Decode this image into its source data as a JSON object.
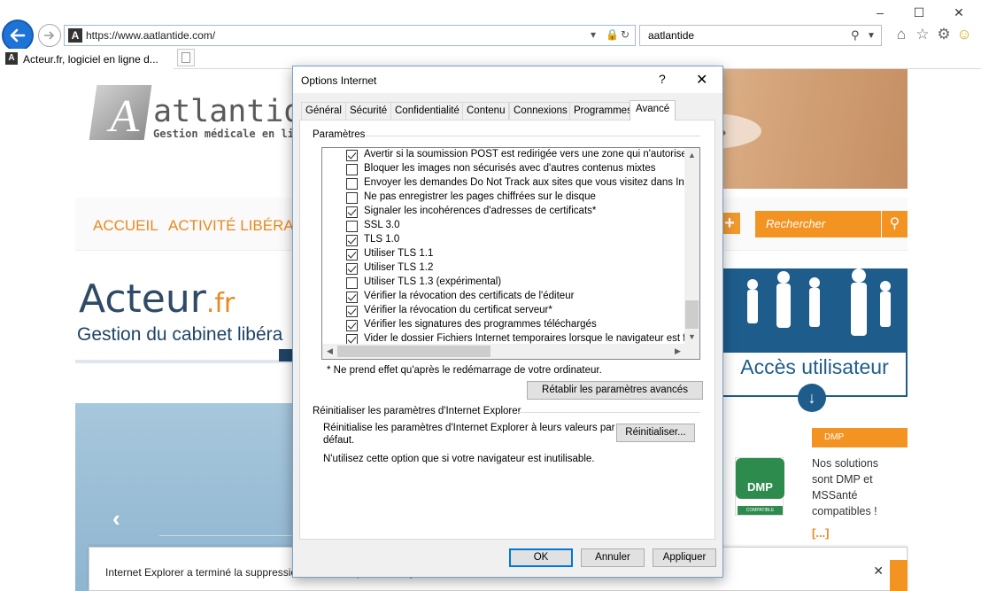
{
  "browser": {
    "url": "https://www.aatlantide.com/",
    "search_query": "aatlantide",
    "tab_title": "Acteur.fr, logiciel en ligne d..."
  },
  "webpage": {
    "logo_text": "atlantide",
    "logo_sub": "Gestion médicale en li",
    "menu": [
      "ACCUEIL",
      "ACTIVITÉ LIBÉRAL"
    ],
    "search_placeholder": "Rechercher",
    "acteur_title": "Acteur",
    "acteur_ext": ".fr",
    "acteur_sub": "Gestion du cabinet libéra",
    "user_access": "Accès utilisateur",
    "dmp_header": "DMP",
    "dmp_logo": "DMP",
    "dmp_logo_caption": "COMPATIBLE",
    "dmp_text": "Nos solutions sont DMP et MSSanté compatibles !",
    "dmp_more": "[...]"
  },
  "notification": {
    "text": "Internet Explorer a terminé la suppression de l'historique de navigation sélectionner."
  },
  "dialog": {
    "title": "Options Internet",
    "help": "?",
    "tabs": [
      "Général",
      "Sécurité",
      "Confidentialité",
      "Contenu",
      "Connexions",
      "Programmes",
      "Avancé"
    ],
    "active_tab": "Avancé",
    "params_label": "Paramètres",
    "settings": [
      {
        "label": "Avertir si la soumission POST est redirigée vers une zone qui n'autorise pas",
        "checked": true
      },
      {
        "label": "Bloquer les images non sécurisés avec d'autres contenus mixtes",
        "checked": false
      },
      {
        "label": "Envoyer les demandes Do Not Track aux sites que vous visitez dans Interne",
        "checked": false
      },
      {
        "label": "Ne pas enregistrer les pages chiffrées sur le disque",
        "checked": false
      },
      {
        "label": "Signaler les incohérences d'adresses de certificats*",
        "checked": true
      },
      {
        "label": "SSL 3.0",
        "checked": false
      },
      {
        "label": "TLS 1.0",
        "checked": true
      },
      {
        "label": "Utiliser TLS 1.1",
        "checked": true
      },
      {
        "label": "Utiliser TLS 1.2",
        "checked": true
      },
      {
        "label": "Utiliser TLS 1.3 (expérimental)",
        "checked": false
      },
      {
        "label": "Vérifier la révocation des certificats de l'éditeur",
        "checked": true
      },
      {
        "label": "Vérifier la révocation du certificat serveur*",
        "checked": true
      },
      {
        "label": "Vérifier les signatures des programmes téléchargés",
        "checked": true
      },
      {
        "label": "Vider le dossier Fichiers Internet temporaires lorsque le navigateur est ferm",
        "checked": true
      }
    ],
    "restart_note": "* Ne prend effet qu'après le redémarrage de votre ordinateur.",
    "restore_button": "Rétablir les paramètres avancés",
    "reset_group": "Réinitialiser les paramètres d'Internet Explorer",
    "reset_desc_1": "Réinitialise les paramètres d'Internet Explorer à leurs valeurs par",
    "reset_desc_2": "défaut.",
    "reset_button": "Réinitialiser...",
    "reset_warning": "N'utilisez cette option que si votre navigateur est inutilisable.",
    "ok": "OK",
    "cancel": "Annuler",
    "apply": "Appliquer"
  }
}
